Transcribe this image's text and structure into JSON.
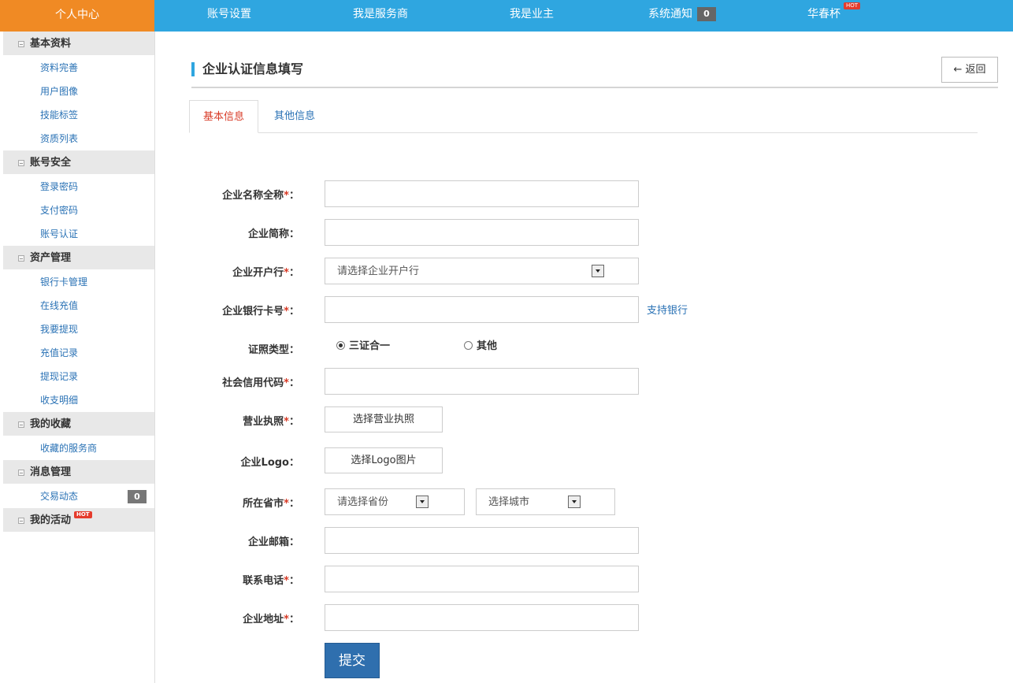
{
  "topbar": {
    "home": "个人中心",
    "nav": [
      "账号设置",
      "我是服务商",
      "我是业主",
      "系统通知"
    ],
    "notice_count": "0",
    "user": "华春杯",
    "hot": "HOT"
  },
  "sidebar": {
    "groups": [
      {
        "title": "基本资料",
        "items": [
          "资料完善",
          "用户图像",
          "技能标签",
          "资质列表"
        ]
      },
      {
        "title": "账号安全",
        "items": [
          "登录密码",
          "支付密码",
          "账号认证"
        ]
      },
      {
        "title": "资产管理",
        "items": [
          "银行卡管理",
          "在线充值",
          "我要提现",
          "充值记录",
          "提现记录",
          "收支明细"
        ]
      },
      {
        "title": "我的收藏",
        "items": [
          "收藏的服务商"
        ]
      },
      {
        "title": "消息管理",
        "items": [
          "交易动态"
        ],
        "count": "0"
      },
      {
        "title": "我的活动",
        "hot": "HOT"
      }
    ]
  },
  "page": {
    "title": "企业认证信息填写",
    "back": "← 返回",
    "tabs": [
      "基本信息",
      "其他信息"
    ]
  },
  "form": {
    "req": "*",
    "colon": "：",
    "labels": {
      "company_name": "企业名称全称",
      "company_short": "企业简称",
      "bank": "企业开户行",
      "bank_card": "企业银行卡号",
      "license_type": "证照类型",
      "credit_code": "社会信用代码",
      "business_license": "营业执照",
      "logo": "企业Logo",
      "region": "所在省市",
      "email": "企业邮箱",
      "phone": "联系电话",
      "address": "企业地址"
    },
    "bank_placeholder": "请选择企业开户行",
    "support_bank": "支持银行",
    "license_options": [
      "三证合一",
      "其他"
    ],
    "license_selected": "三证合一",
    "license_btn": "选择营业执照",
    "logo_btn": "选择Logo图片",
    "province_placeholder": "请选择省份",
    "city_placeholder": "选择城市",
    "submit": "提交"
  }
}
